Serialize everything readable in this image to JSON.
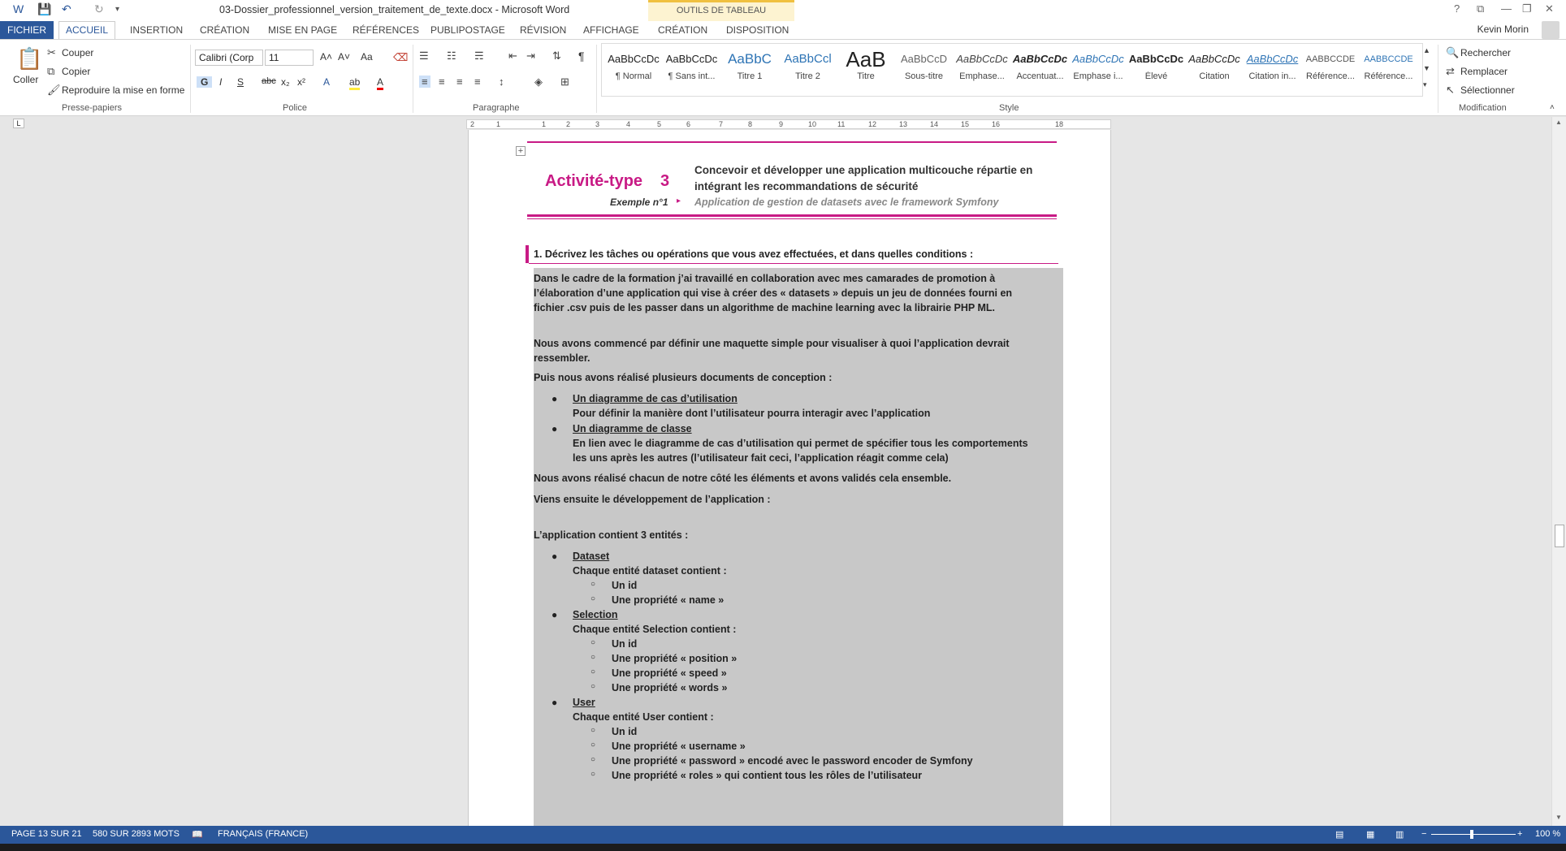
{
  "window": {
    "title": "03-Dossier_professionnel_version_traitement_de_texte.docx - Microsoft Word",
    "table_tools_label": "OUTILS DE TABLEAU",
    "user_name": "Kevin Morin"
  },
  "tabs": {
    "file": "FICHIER",
    "home": "ACCUEIL",
    "insert": "INSERTION",
    "design": "CRÉATION",
    "layout": "MISE EN PAGE",
    "references": "RÉFÉRENCES",
    "mailings": "PUBLIPOSTAGE",
    "review": "RÉVISION",
    "view": "AFFICHAGE",
    "table_design": "CRÉATION",
    "table_layout": "DISPOSITION"
  },
  "ribbon": {
    "clipboard": {
      "paste": "Coller",
      "cut": "Couper",
      "copy": "Copier",
      "format_painter": "Reproduire la mise en forme",
      "label": "Presse-papiers"
    },
    "font": {
      "family": "Calibri (Corp",
      "size": "11",
      "label": "Police",
      "bold": "G",
      "italic": "I",
      "underline": "S",
      "strike": "abc",
      "subscript": "x₂",
      "superscript": "x²",
      "grow": "A˄",
      "shrink": "A˅",
      "case": "Aa",
      "text_effects": "A",
      "highlight": "ab",
      "font_color": "A"
    },
    "paragraph": {
      "label": "Paragraphe",
      "pilcrow": "¶"
    },
    "styles": {
      "label": "Style",
      "items": [
        {
          "sample": "AaBbCcDc",
          "name": "¶ Normal"
        },
        {
          "sample": "AaBbCcDc",
          "name": "¶ Sans int..."
        },
        {
          "sample": "AaBbC",
          "name": "Titre 1"
        },
        {
          "sample": "AaBbCcl",
          "name": "Titre 2"
        },
        {
          "sample": "AaB",
          "name": "Titre"
        },
        {
          "sample": "AaBbCcD",
          "name": "Sous-titre"
        },
        {
          "sample": "AaBbCcDc",
          "name": "Emphase..."
        },
        {
          "sample": "AaBbCcDc",
          "name": "Accentuat..."
        },
        {
          "sample": "AaBbCcDc",
          "name": "Emphase i..."
        },
        {
          "sample": "AaBbCcDc",
          "name": "Élevé"
        },
        {
          "sample": "AaBbCcDc",
          "name": "Citation"
        },
        {
          "sample": "AaBbCcDc",
          "name": "Citation in..."
        },
        {
          "sample": "AABBCCDE",
          "name": "Référence..."
        },
        {
          "sample": "AABBCCDE",
          "name": "Référence..."
        }
      ]
    },
    "editing": {
      "label": "Modification",
      "find": "Rechercher",
      "replace": "Remplacer",
      "select": "Sélectionner"
    }
  },
  "ruler": {
    "ticks": [
      "2",
      "1",
      "1",
      "2",
      "3",
      "4",
      "5",
      "6",
      "7",
      "8",
      "9",
      "10",
      "11",
      "12",
      "13",
      "14",
      "15",
      "16",
      "18"
    ]
  },
  "document": {
    "activity_label": "Activité-type",
    "activity_number": "3",
    "activity_title_line1": "Concevoir et développer une application multicouche répartie en",
    "activity_title_line2": "intégrant les recommandations de sécurité",
    "example_label": "Exemple n°1",
    "example_title": "Application de gestion de datasets avec le framework Symfony",
    "question": "1. Décrivez les tâches ou opérations que vous avez effectuées, et dans quelles conditions :",
    "p1_l1": "Dans le cadre de la formation j’ai travaillé en collaboration avec mes camarades de promotion à",
    "p1_l2": "l’élaboration d’une application qui vise à créer des « datasets » depuis un jeu de données fourni en",
    "p1_l3": "fichier .csv puis de les passer dans un algorithme de machine learning avec la librairie PHP ML.",
    "p2_l1": "Nous avons commencé par définir une maquette simple pour visualiser à quoi l’application devrait",
    "p2_l2": "ressembler.",
    "p3": "Puis nous avons réalisé plusieurs documents de conception :",
    "b1_title": "Un diagramme de cas d’utilisation",
    "b1_desc": "Pour définir la manière dont l’utilisateur pourra interagir avec l’application",
    "b2_title": "Un diagramme de classe",
    "b2_desc_l1": "En lien avec le diagramme de cas d’utilisation qui permet de spécifier tous les comportements",
    "b2_desc_l2": "les uns après les autres (l’utilisateur fait ceci, l’application réagit comme cela)",
    "p4": "Nous avons réalisé chacun de notre côté les éléments et avons validés cela ensemble.",
    "p5": "Viens ensuite le développement de l’application :",
    "p6": "L’application contient 3 entités :",
    "e1_title": "Dataset",
    "e1_desc": "Chaque entité dataset contient :",
    "e1_items": [
      "Un id",
      "Une propriété « name »"
    ],
    "e2_title": "Selection",
    "e2_desc": "Chaque entité Selection contient :",
    "e2_items": [
      "Un id",
      "Une propriété « position »",
      "Une propriété « speed »",
      "Une propriété « words »"
    ],
    "e3_title": "User",
    "e3_desc": "Chaque entité User contient :",
    "e3_items": [
      "Un id",
      "Une propriété « username »",
      "Une propriété « password » encodé avec le password encoder de Symfony",
      "Une propriété « roles » qui contient tous les rôles de l’utilisateur"
    ]
  },
  "status": {
    "page": "PAGE 13 SUR 21",
    "words": "580 SUR 2893 MOTS",
    "language": "FRANÇAIS (FRANCE)",
    "zoom": "100 %"
  },
  "colors": {
    "accent": "#2b579a",
    "magenta": "#c81a85",
    "shade": "#c8c8c8"
  }
}
